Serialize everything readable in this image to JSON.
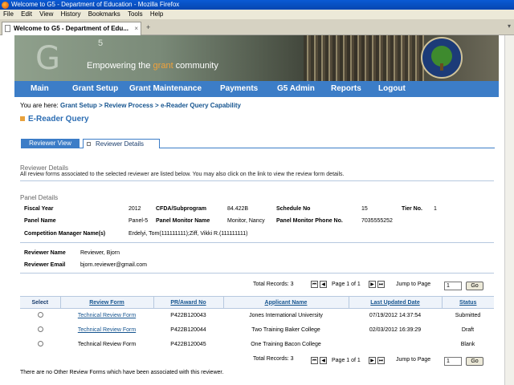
{
  "window": {
    "title": "Welcome to G5 - Department of Education - Mozilla Firefox",
    "menu": [
      "File",
      "Edit",
      "View",
      "History",
      "Bookmarks",
      "Tools",
      "Help"
    ],
    "tab_title": "Welcome to G5 - Department of Edu..."
  },
  "banner": {
    "logo": "G",
    "logo_sup": "5",
    "slogan_pre": "Empowering the ",
    "slogan_hl": "grant",
    "slogan_post": " community"
  },
  "nav": [
    "Main",
    "Grant Setup",
    "Grant Maintenance",
    "Payments",
    "G5 Admin",
    "Reports",
    "Logout"
  ],
  "breadcrumb": {
    "prefix": "You are here: ",
    "items": [
      "Grant Setup",
      "Review Process",
      "e-Reader Query Capability"
    ],
    "sep": " > "
  },
  "page_title": "E-Reader Query",
  "tabs": [
    "Reviewer View",
    "Reviewer Details"
  ],
  "reviewer_details": {
    "title": "Reviewer Details",
    "desc": "All review forms associated to the selected reviewer are listed below. You may also click on the link to view the review form details."
  },
  "panel": {
    "title": "Panel Details",
    "fiscal_year_label": "Fiscal Year",
    "fiscal_year": "2012",
    "cfda_label": "CFDA/Subprogram",
    "cfda": "84.422B",
    "schedule_label": "Schedule No",
    "schedule": "15",
    "tier_label": "Tier No.",
    "tier": "1",
    "panel_name_label": "Panel Name",
    "panel_name": "Panel-5",
    "monitor_name_label": "Panel Monitor Name",
    "monitor_name": "Monitor, Nancy",
    "monitor_phone_label": "Panel Monitor Phone No.",
    "monitor_phone": "7035555252",
    "comp_mgr_label": "Competition Manager Name(s)",
    "comp_mgr": "Erdelyi, Tom(111111111);Ziff, Vikki R.(111111111)"
  },
  "reviewer": {
    "name_label": "Reviewer Name",
    "name": "Reviewer, Bjorn",
    "email_label": "Reviewer Email",
    "email": "bjorn.reviewer@gmail.com"
  },
  "pager": {
    "total": "Total Records: 3",
    "page_info": "Page 1 of 1",
    "jump_label": "Jump to Page",
    "jump_value": "1",
    "go": "Go"
  },
  "table": {
    "headers": [
      "Select",
      "Review Form",
      "PR/Award No",
      "Applicant Name",
      "Last Updated Date",
      "Status"
    ],
    "rows": [
      {
        "form": "Technical Review Form",
        "award": "P422B120043",
        "applicant": "Jones International University",
        "updated": "07/19/2012 14:37:54",
        "status": "Submitted"
      },
      {
        "form": "Technical Review Form",
        "award": "P422B120044",
        "applicant": "Two Training Baker College",
        "updated": "02/03/2012 16:39:29",
        "status": "Draft"
      },
      {
        "form": "Technical Review Form",
        "award": "P422B120045",
        "applicant": "One Training Bacon College",
        "updated": "",
        "status": "Blank"
      }
    ]
  },
  "footnote": "There are no Other Review Forms which have been associated with this reviewer."
}
